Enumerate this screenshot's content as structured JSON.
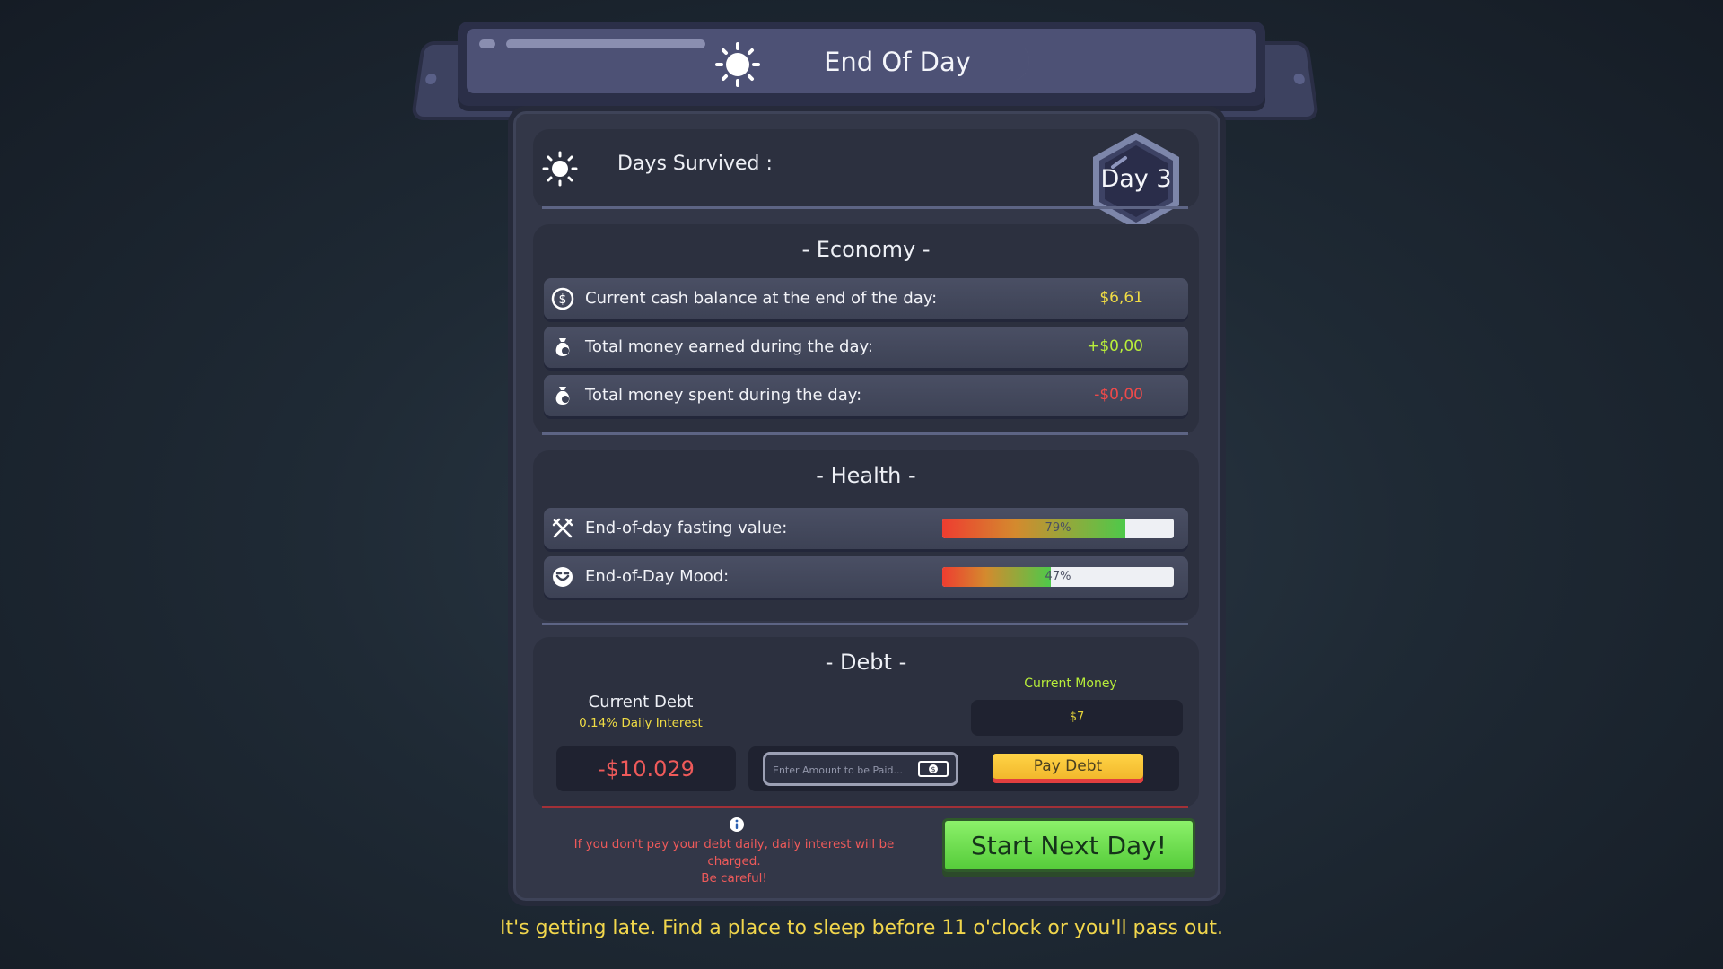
{
  "header": {
    "title": "End Of Day",
    "sun_icon": "sun-icon",
    "moon_icon": "moon-icon"
  },
  "days": {
    "label": "Days Survived :",
    "value": "Day 3"
  },
  "economy": {
    "title": "- Economy -",
    "rows": [
      {
        "icon": "dollar-coin-icon",
        "label": "Current cash balance at the end of the day:",
        "value": "$6,61",
        "color": "#f0dc44"
      },
      {
        "icon": "money-bag-icon",
        "label": "Total money earned during the day:",
        "value": "+$0,00",
        "color": "#b9ee3a"
      },
      {
        "icon": "money-bag-icon",
        "label": "Total money spent during the day:",
        "value": "-$0,00",
        "color": "#ee4a4a"
      }
    ]
  },
  "health": {
    "title": "- Health -",
    "rows": [
      {
        "icon": "fork-knife-icon",
        "label": "End-of-day fasting value:",
        "percent_text": "79%",
        "fraction": 0.79
      },
      {
        "icon": "smiley-icon",
        "label": "End-of-Day Mood:",
        "percent_text": "47%",
        "fraction": 0.47
      }
    ]
  },
  "debt": {
    "title": "- Debt -",
    "current_debt_label": "Current Debt",
    "interest": "0.14% Daily Interest",
    "debt_value": "-$10.029",
    "current_money_label": "Current Money",
    "current_money_value": "$7",
    "amount_placeholder": "Enter Amount to be Paid...",
    "pay_button": "Pay Debt"
  },
  "warning": {
    "line1": "If you don't pay your debt daily, daily interest will be charged.",
    "line2": "Be careful!"
  },
  "start_button": "Start Next Day!",
  "footer_message": "It's getting late. Find a place to sleep before 11 o'clock or you'll pass out.",
  "colors": {
    "accent_yellow": "#f0dc44",
    "positive_green": "#b9ee3a",
    "negative_red": "#ee4a4a",
    "start_button_green": "#6fe04a"
  }
}
